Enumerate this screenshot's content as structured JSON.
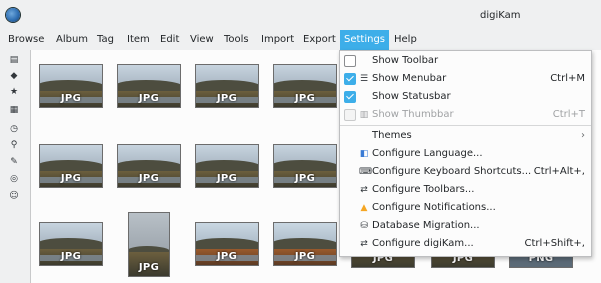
{
  "window": {
    "title": "digiKam"
  },
  "menubar": {
    "items": [
      {
        "label": "Browse"
      },
      {
        "label": "Album"
      },
      {
        "label": "Tag"
      },
      {
        "label": "Item"
      },
      {
        "label": "Edit"
      },
      {
        "label": "View"
      },
      {
        "label": "Tools"
      },
      {
        "label": "Import"
      },
      {
        "label": "Export"
      },
      {
        "label": "Settings",
        "active": true
      },
      {
        "label": "Help"
      }
    ]
  },
  "sidebar": {
    "icons": [
      "albums-icon",
      "tags-icon",
      "star-icon",
      "calendar-icon",
      "timeline-icon",
      "search-icon",
      "fuzzy-search-icon",
      "map-icon",
      "people-icon"
    ]
  },
  "grid": {
    "thumbnails": [
      {
        "badge": "JPG"
      },
      {
        "badge": "JPG"
      },
      {
        "badge": "JPG"
      },
      {
        "badge": "JPG"
      },
      {
        "badge": "JPG"
      },
      {
        "badge": "JPG"
      },
      {
        "badge": "JPG"
      },
      {
        "badge": "JPG"
      },
      {
        "badge": "JPG"
      },
      {
        "badge": "JPG"
      },
      {
        "badge": "JPG"
      },
      {
        "badge": "JPG"
      },
      {
        "badge": "JPG"
      },
      {
        "badge": "JPG"
      },
      {
        "badge": "PNG"
      }
    ]
  },
  "settings_menu": {
    "show_toolbar": {
      "label": "Show Toolbar",
      "checked": false
    },
    "show_menubar": {
      "label": "Show Menubar",
      "shortcut": "Ctrl+M",
      "checked": true
    },
    "show_statusbar": {
      "label": "Show Statusbar",
      "checked": true
    },
    "show_thumbbar": {
      "label": "Show Thumbbar",
      "shortcut": "Ctrl+T",
      "checked": false,
      "disabled": true
    },
    "themes": {
      "label": "Themes"
    },
    "configure_language": {
      "label": "Configure Language..."
    },
    "configure_shortcuts": {
      "label": "Configure Keyboard Shortcuts...",
      "shortcut": "Ctrl+Alt+,"
    },
    "configure_toolbars": {
      "label": "Configure Toolbars..."
    },
    "configure_notifications": {
      "label": "Configure Notifications..."
    },
    "database_migration": {
      "label": "Database Migration..."
    },
    "configure_digikam": {
      "label": "Configure digiKam...",
      "shortcut": "Ctrl+Shift+,"
    }
  },
  "colors": {
    "accent": "#3daee9",
    "notification": "#f5a623",
    "language": "#3a7bd5"
  }
}
